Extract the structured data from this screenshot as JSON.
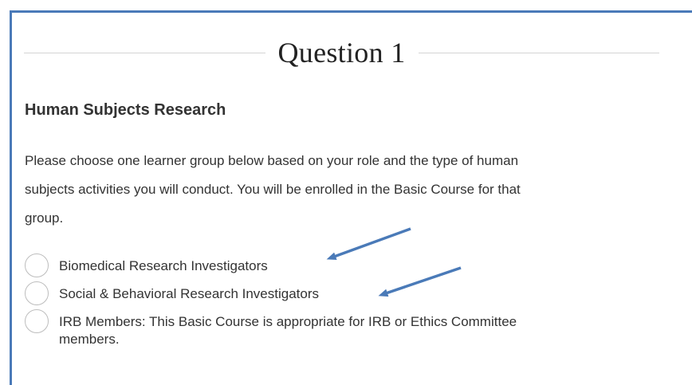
{
  "question": {
    "title": "Question 1"
  },
  "section": {
    "heading": "Human Subjects Research",
    "instructions_lines": [
      "Please choose one learner group below based on your role and the type of human",
      "subjects activities you will conduct. You will be enrolled in the Basic Course for that",
      "group."
    ]
  },
  "options": [
    {
      "label_lines": [
        "Biomedical Research Investigators"
      ],
      "selected": false
    },
    {
      "label_lines": [
        "Social & Behavioral Research Investigators"
      ],
      "selected": false
    },
    {
      "label_lines": [
        "IRB Members: This Basic Course is appropriate for IRB or Ethics Committee",
        "members."
      ],
      "selected": false
    }
  ],
  "colors": {
    "frame_border": "#4a7ab8",
    "annotation_arrow": "#4a7ab8",
    "text": "#333333",
    "radio_border": "#bdbdbd"
  },
  "icons": {
    "annotation": "arrow-icon"
  }
}
